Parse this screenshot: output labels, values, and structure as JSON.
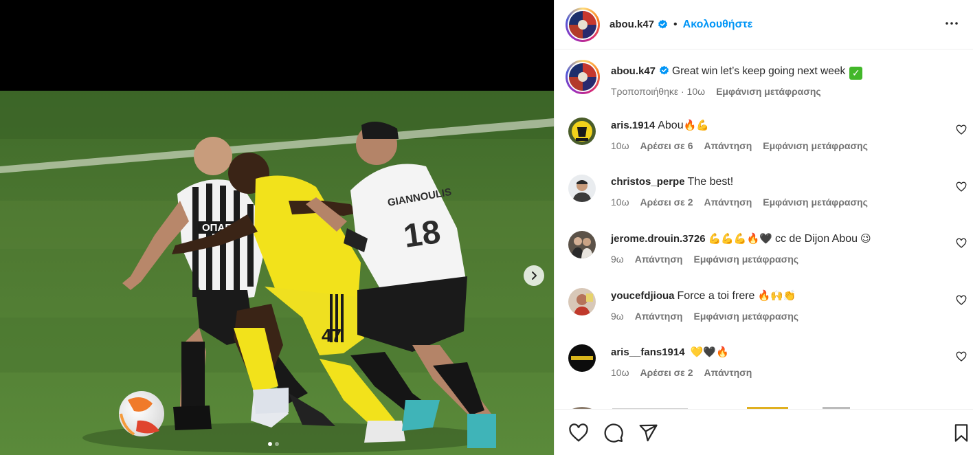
{
  "post": {
    "username": "abou.k47",
    "follow_label": "Ακολουθήστε",
    "separator": "•",
    "caption": "Great win let’s keep going next week",
    "caption_emoji": "✓",
    "caption_meta_edited": "Τροποποιήθηκε · 10ω",
    "caption_translate": "Εμφάνιση μετάφρασης"
  },
  "comments": [
    {
      "user": "aris.1914",
      "text": "Abou",
      "emoji": "🔥💪",
      "time": "10ω",
      "likes": "Αρέσει σε 6",
      "reply": "Απάντηση",
      "translate": "Εμφάνιση μετάφρασης"
    },
    {
      "user": "christos_perpe",
      "text": "The best!",
      "emoji": "",
      "time": "10ω",
      "likes": "Αρέσει σε 2",
      "reply": "Απάντηση",
      "translate": "Εμφάνιση μετάφρασης"
    },
    {
      "user": "jerome.drouin.3726",
      "text": "cc de Dijon Abou",
      "emoji_before": "💪💪💪🔥🖤",
      "emoji": "😉",
      "time": "9ω",
      "reply": "Απάντηση",
      "translate": "Εμφάνιση μετάφρασης"
    },
    {
      "user": "youcefdjioua",
      "text": "Force a toi frere",
      "emoji": "🔥🙌👏",
      "time": "9ω",
      "reply": "Απάντηση",
      "translate": "Εμφάνιση μετάφρασης"
    },
    {
      "user": "aris__fans1914",
      "text": "",
      "emoji": "💛🖤🔥",
      "time": "10ω",
      "likes": "Αρέσει σε 2",
      "reply": "Απάντηση"
    }
  ],
  "media": {
    "carousel_index": 1,
    "carousel_count": 2,
    "player_names": {
      "white_back": "GIANNOULIS",
      "white_number": "18",
      "yellow_number": "47",
      "sponsor": "ΟΠΑΠ"
    }
  },
  "colors": {
    "link_blue": "#0095f6",
    "verified_blue": "#0095f6",
    "secondary_text": "#737373",
    "pitch_green": "#4f7a32",
    "aris_yellow": "#f2e21b"
  },
  "icons": {
    "more": "more-horizontal-icon",
    "like": "heart-icon",
    "comment": "comment-icon",
    "share": "share-icon",
    "save": "bookmark-icon",
    "next": "chevron-right-icon",
    "verified": "verified-badge-icon"
  }
}
